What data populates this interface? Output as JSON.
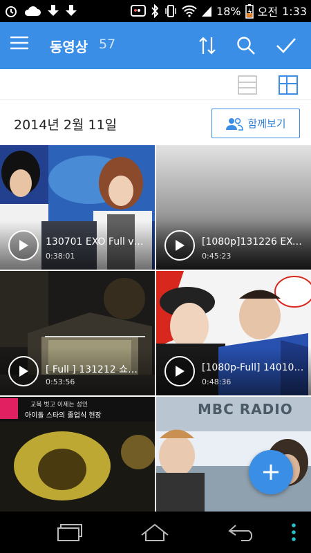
{
  "status_bar": {
    "battery": "18%",
    "ampm": "오전",
    "time": "1:33",
    "icons": [
      "alarm-icon",
      "cloud-icon",
      "download-icon",
      "download-icon",
      "bbm-icon",
      "bluetooth-icon",
      "vibrate-icon",
      "wifi-icon",
      "signal-icon",
      "battery-charging-icon"
    ]
  },
  "app_bar": {
    "title": "동영상",
    "count": "57",
    "color": "#3a8ee6",
    "actions": [
      "sort-icon",
      "search-icon",
      "check-icon"
    ]
  },
  "view_toggle": {
    "options": [
      "list-view-icon",
      "grid-view-icon"
    ],
    "selected": "grid-view-icon"
  },
  "date_header": {
    "date": "2014년 2월 11일",
    "watch_together_label": "함께보기"
  },
  "videos": [
    {
      "title": "130701 EXO Full v…",
      "duration": "0:38:01"
    },
    {
      "title": "[1080p]131226 EXO…",
      "duration": "0:45:23"
    },
    {
      "title": " [ Full ] 131212 쇼…",
      "duration": "0:53:56"
    },
    {
      "title": "[1080p-Full] 14010…",
      "duration": "0:48:36"
    }
  ],
  "partial_tiles": {
    "tile5_caption": "교복 벗고 이제는 성인",
    "tile5_caption2": "아이돌 스타의 졸업식 현장",
    "tile6_sign": "MBC RADIO"
  },
  "fab": {
    "icon": "plus-icon"
  },
  "nav_bar": {
    "buttons": [
      "recent-apps-icon",
      "home-icon",
      "back-icon",
      "menu-dots-icon"
    ]
  }
}
